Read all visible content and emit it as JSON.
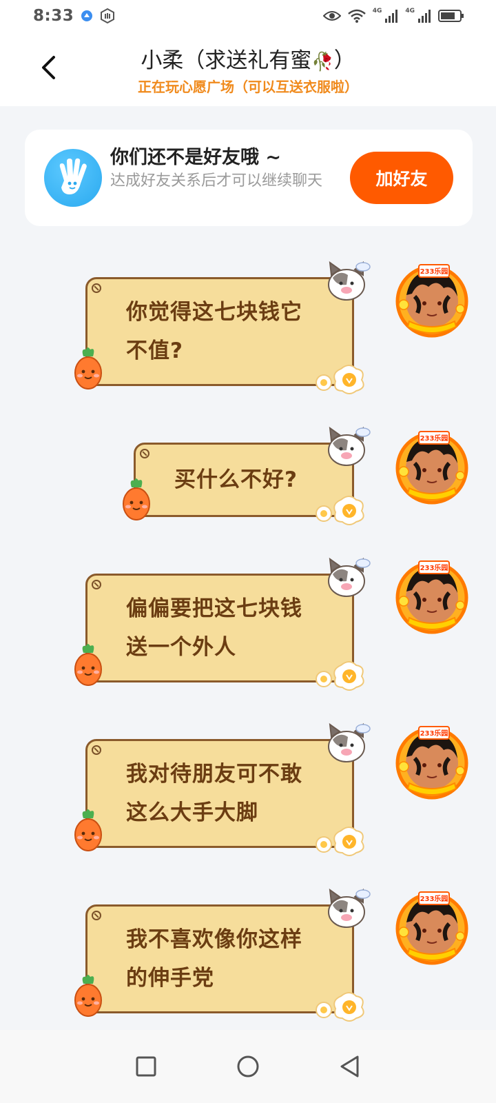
{
  "status_bar": {
    "time": "8:33",
    "network_label_1": "4G",
    "network_label_2": "4G"
  },
  "header": {
    "title": "小柔（求送礼有蜜",
    "title_emoji": "🥀",
    "title_suffix": "）",
    "subtitle": "正在玩心愿广场（可以互送衣服啦）"
  },
  "friend_banner": {
    "title": "你们还不是好友哦 ~",
    "description": "达成好友关系后才可以继续聊天",
    "button_label": "加好友"
  },
  "messages": [
    {
      "lines": [
        "你觉得这七块钱它",
        "不值?"
      ]
    },
    {
      "lines": [
        "买什么不好?"
      ]
    },
    {
      "lines": [
        "偏偏要把这七块钱",
        "送一个外人"
      ]
    },
    {
      "lines": [
        "我对待朋友可不敢",
        "这么大手大脚"
      ]
    },
    {
      "lines": [
        "我不喜欢像你这样",
        "的伸手党"
      ]
    }
  ],
  "avatar_badge": "233乐园",
  "colors": {
    "accent_orange": "#ff5a00",
    "subtitle_orange": "#f08a1c",
    "bubble_fill": "#f6dd9b",
    "bubble_border": "#8a5a2b",
    "bubble_text": "#6b3d12"
  },
  "icons": {
    "back": "chevron-left-icon",
    "nav_recent": "square-icon",
    "nav_home": "circle-icon",
    "nav_back": "triangle-back-icon"
  }
}
